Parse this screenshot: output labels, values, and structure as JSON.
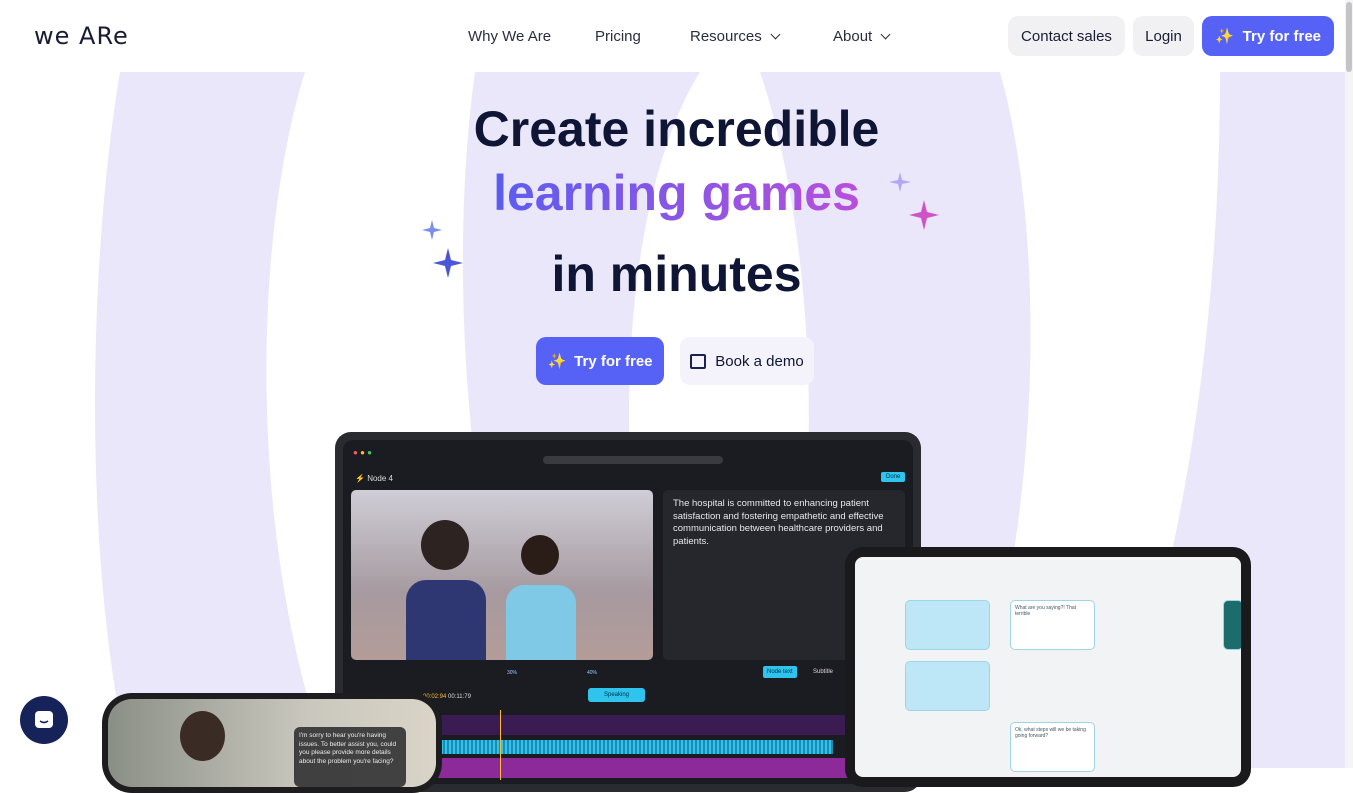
{
  "nav": {
    "logo": "we ARe",
    "links": [
      "Why We Are",
      "Pricing",
      "Resources",
      "About"
    ],
    "contact_sales": "Contact sales",
    "login": "Login",
    "try_free": "Try for free"
  },
  "hero": {
    "line1": "Create incredible",
    "line2": "learning games",
    "line3": "in minutes",
    "try_free": "Try for free",
    "book_demo": "Book a demo"
  },
  "laptop": {
    "node_title": "Node 4",
    "done": "Done",
    "description": "The hospital is committed to enhancing patient satisfaction and fostering empathetic and effective communication between healthcare providers and patients.",
    "zoom_pct": "30%",
    "volume_pct": "40%",
    "node_text": "Node text",
    "subtitle": "Subtitle",
    "time": "00:02:94",
    "duration": "00:11:79",
    "speaking": "Speaking"
  },
  "phone": {
    "bubble": "I'm sorry to hear you're having issues. To better assist you, could you please provide more details about the problem you're facing?"
  },
  "tablet": {
    "node1": "What are you saying?! That terrible",
    "node2": "Ok, what steps will we be taking going forward?"
  },
  "colors": {
    "primary": "#5662f6",
    "lavender": "#ebe6fb",
    "navy": "#0f1535"
  }
}
